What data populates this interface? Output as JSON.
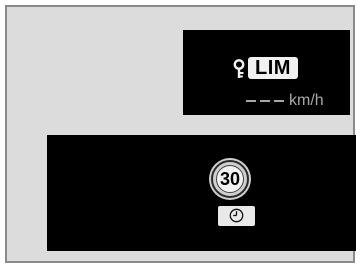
{
  "top_display": {
    "indicator_label": "LIM",
    "indicator_icon": "speed-limiter-key-icon",
    "speed_placeholder": "---",
    "speed_unit": "km/h"
  },
  "bottom_display": {
    "sign_value": "30",
    "sign_icon": "speed-limit-sign-icon",
    "timer_icon": "clock-icon"
  },
  "colors": {
    "panel": "#dcdcdc",
    "screen": "#000000",
    "dim_text": "#a7a7a7",
    "label_bg": "#f1f1f1"
  }
}
